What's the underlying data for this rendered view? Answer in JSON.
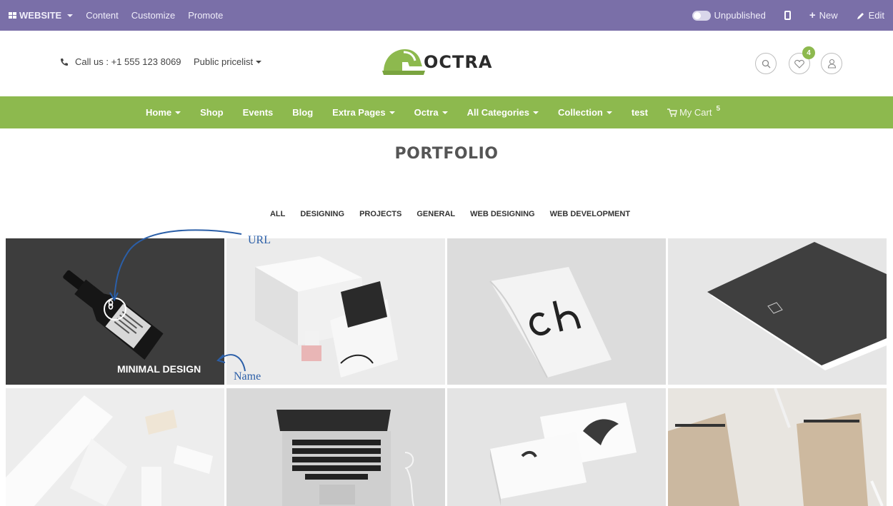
{
  "admin_bar": {
    "website_label": "WEBSITE",
    "items": [
      "Content",
      "Customize",
      "Promote"
    ],
    "publish_status": "Unpublished",
    "new_label": "New",
    "edit_label": "Edit"
  },
  "header": {
    "call_text": "Call us : +1 555 123 8069",
    "pricelist": "Public pricelist",
    "logo_text": "OCTRA",
    "wishlist_count": "4",
    "icons": [
      "search-icon",
      "heart-icon",
      "user-icon"
    ]
  },
  "nav": {
    "items": [
      {
        "label": "Home",
        "dropdown": true
      },
      {
        "label": "Shop",
        "dropdown": false
      },
      {
        "label": "Events",
        "dropdown": false
      },
      {
        "label": "Blog",
        "dropdown": false
      },
      {
        "label": "Extra Pages",
        "dropdown": true
      },
      {
        "label": "Octra",
        "dropdown": true
      },
      {
        "label": "All Categories",
        "dropdown": true
      },
      {
        "label": "Collection",
        "dropdown": true
      },
      {
        "label": "test",
        "dropdown": false
      }
    ],
    "cart_label": "My Cart",
    "cart_count": "5"
  },
  "portfolio": {
    "title": "PORTFOLIO",
    "filters": [
      "ALL",
      "DESIGNING",
      "PROJECTS",
      "GENERAL",
      "WEB DESIGNING",
      "WEB DEVELOPMENT"
    ],
    "first_item_name": "MINIMAL DESIGN"
  },
  "annotations": {
    "url_label": "URL",
    "name_label": "Name"
  },
  "colors": {
    "admin_bar": "#7a6fa8",
    "accent_green": "#8db94e",
    "annotation_blue": "#2b5fa8"
  }
}
